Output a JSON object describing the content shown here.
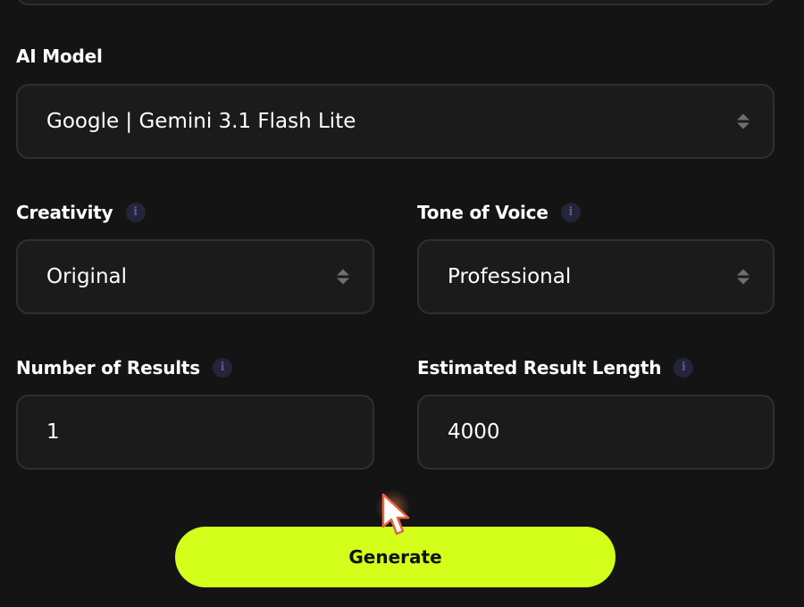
{
  "form": {
    "ai_model": {
      "label": "AI Model",
      "value": "Google | Gemini 3.1 Flash Lite"
    },
    "creativity": {
      "label": "Creativity",
      "value": "Original",
      "info_icon": "info-icon"
    },
    "tone_of_voice": {
      "label": "Tone of Voice",
      "value": "Professional",
      "info_icon": "info-icon"
    },
    "number_of_results": {
      "label": "Number of Results",
      "value": "1",
      "info_icon": "info-icon"
    },
    "estimated_result_length": {
      "label": "Estimated Result Length",
      "value": "4000",
      "info_icon": "info-icon"
    },
    "generate_label": "Generate"
  },
  "colors": {
    "background": "#141414",
    "field_background": "#1b1b1b",
    "field_border": "#2f2f2f",
    "accent": "#d4ff1a"
  }
}
